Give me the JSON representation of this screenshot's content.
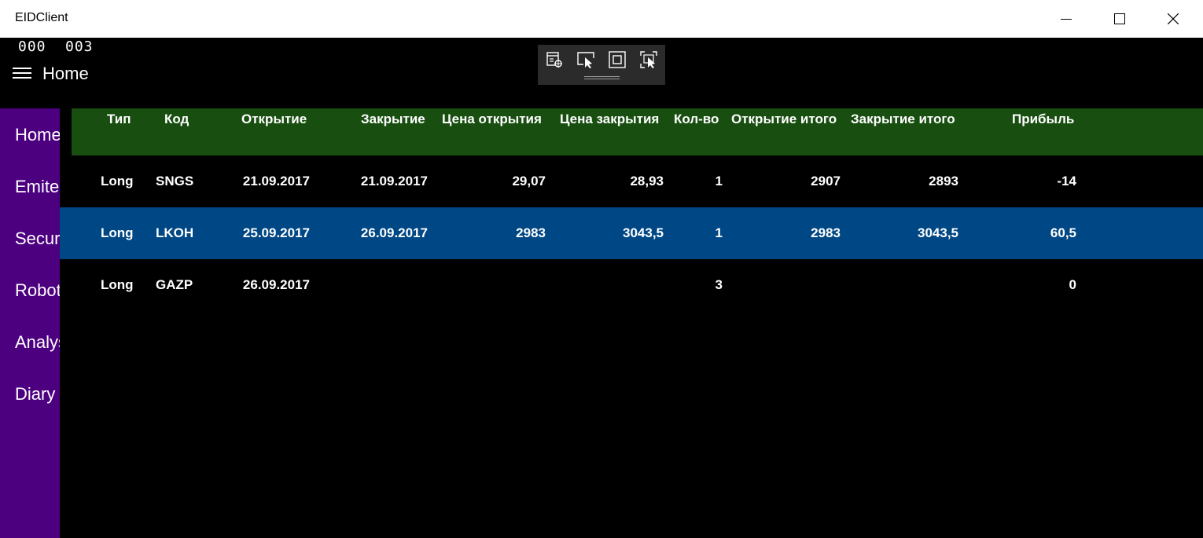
{
  "window": {
    "title": "EIDClient",
    "controls": [
      "minimize-icon",
      "maximize-icon",
      "close-icon"
    ]
  },
  "frame_counters": [
    "000",
    "003"
  ],
  "header": {
    "menu_icon": "hamburger-icon",
    "title": "Home"
  },
  "debug_toolbar": {
    "icons": [
      "visual-tree-icon",
      "select-element-icon",
      "display-layout-adorners-icon",
      "track-focus-icon"
    ]
  },
  "sidebar": {
    "items": [
      {
        "label": "Home"
      },
      {
        "label": "Emitents"
      },
      {
        "label": "Securities"
      },
      {
        "label": "Robots"
      },
      {
        "label": "Analysis"
      },
      {
        "label": "Diary"
      }
    ]
  },
  "table": {
    "columns": [
      "Тип",
      "Код",
      "Открытие",
      "Закрытие",
      "Цена открытия",
      "Цена закрытия",
      "Кол-во",
      "Открытие итого",
      "Закрытие итого",
      "Прибыль"
    ],
    "rows": [
      {
        "type": "Long",
        "code": "SNGS",
        "open_date": "21.09.2017",
        "close_date": "21.09.2017",
        "open_price": "29,07",
        "close_price": "28,93",
        "qty": "1",
        "open_total": "2907",
        "close_total": "2893",
        "profit": "-14"
      },
      {
        "type": "Long",
        "code": "LKOH",
        "open_date": "25.09.2017",
        "close_date": "26.09.2017",
        "open_price": "2983",
        "close_price": "3043,5",
        "qty": "1",
        "open_total": "2983",
        "close_total": "3043,5",
        "profit": "60,5"
      },
      {
        "type": "Long",
        "code": "GAZP",
        "open_date": "26.09.2017",
        "close_date": "",
        "open_price": "",
        "close_price": "",
        "qty": "3",
        "open_total": "",
        "close_total": "",
        "profit": "0"
      }
    ],
    "selected_row": 1
  },
  "colors": {
    "background": "#000000",
    "sidebar": "#4c0080",
    "table_header": "#184e10",
    "selected_row": "#004785",
    "titlebar": "#ffffff",
    "debug_toolbar": "#2b2b2b"
  }
}
